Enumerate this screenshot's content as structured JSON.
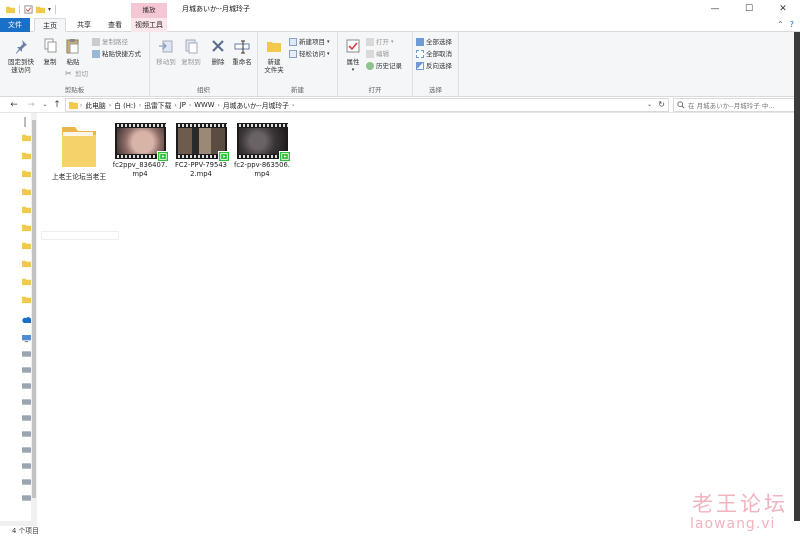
{
  "window": {
    "title": "月城あいか--月城玲子",
    "minimize_glyph": "—",
    "maximize_glyph": "☐",
    "close_glyph": "✕"
  },
  "ribbon_tabs": {
    "file": "文件",
    "home": "主页",
    "share": "共享",
    "view": "查看",
    "play_context": "播放",
    "video_tools": "视频工具"
  },
  "ribbon": {
    "clipboard": {
      "label": "剪贴板",
      "pin": "固定到快\n速访问",
      "copy": "复制",
      "paste": "粘贴",
      "copy_path": "复制路径",
      "paste_shortcut": "粘贴快捷方式",
      "cut": "剪切"
    },
    "organize": {
      "label": "组织",
      "move_to": "移动到",
      "copy_to": "复制到",
      "delete": "删除",
      "rename": "重命名"
    },
    "new": {
      "label": "新建",
      "new_folder": "新建\n文件夹",
      "new_item": "新建项目",
      "easy_access": "轻松访问"
    },
    "open": {
      "label": "打开",
      "properties": "属性",
      "open": "打开",
      "edit": "编辑",
      "history": "历史记录"
    },
    "select": {
      "label": "选择",
      "select_all": "全部选择",
      "select_none": "全部取消",
      "invert": "反向选择"
    }
  },
  "address": {
    "crumbs": [
      "此电脑",
      "白 (H:)",
      "迅雷下载",
      "JP",
      "WWW",
      "月城あいか--月城玲子"
    ],
    "search_placeholder": "在 月城あいか--月城玲子 中..."
  },
  "files": [
    {
      "name": "上老王论坛当老王",
      "type": "folder"
    },
    {
      "name": "fc2ppv_836407.mp4",
      "type": "video",
      "thumb_color": "#b78e86"
    },
    {
      "name": "FC2-PPV-795432.mp4",
      "type": "video",
      "thumb_color": "#7a6a5e"
    },
    {
      "name": "fc2-ppv-863506.mp4",
      "type": "video",
      "thumb_color": "#4a4546"
    }
  ],
  "status": {
    "item_count": "4 个项目"
  },
  "watermark": {
    "cn": "老王论坛",
    "en": "laowang.vi"
  },
  "colors": {
    "accent": "#1a6fc9",
    "context_tab": "#f5c6d3",
    "folder_yellow": "#f6d26b",
    "video_badge": "#2fbf3a"
  }
}
